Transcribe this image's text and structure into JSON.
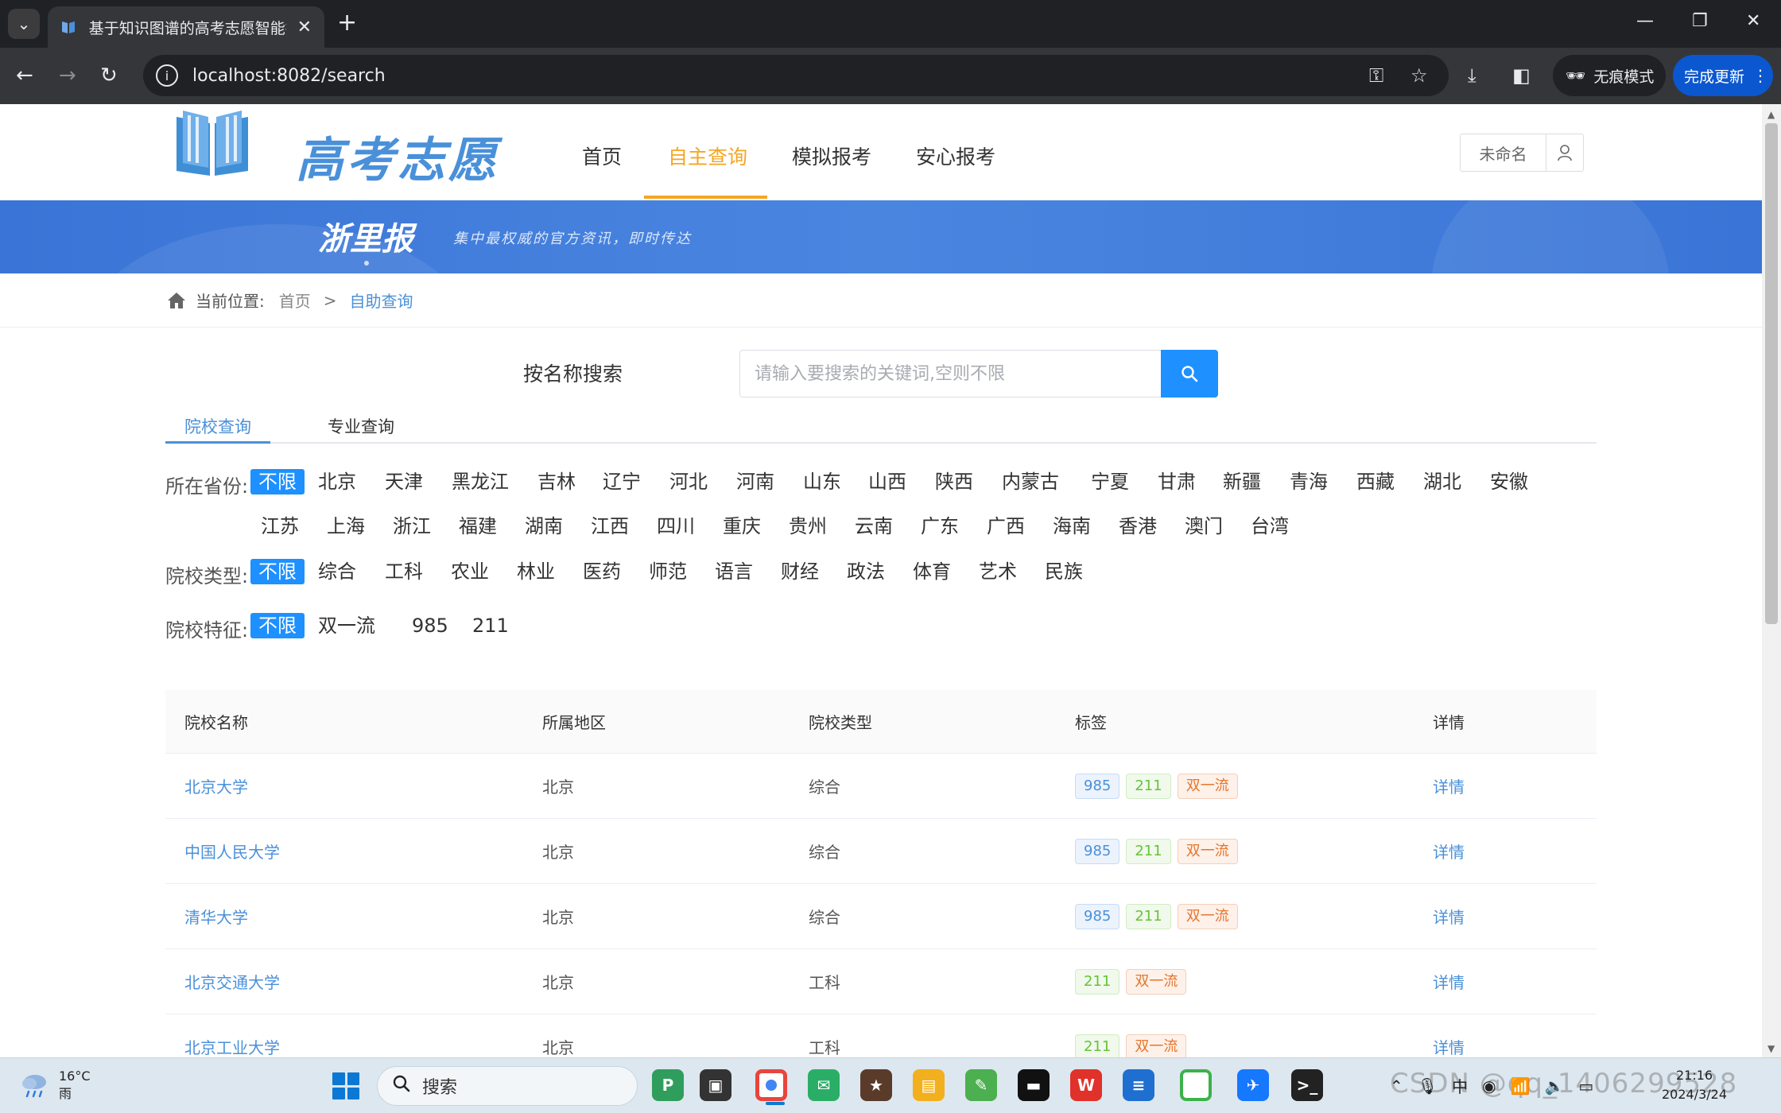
{
  "browser": {
    "tab_title": "基于知识图谱的高考志愿智能推",
    "url": "localhost:8082/search",
    "incognito_label": "无痕模式",
    "update_label": "完成更新"
  },
  "site": {
    "logo_text": "高考志愿",
    "nav": [
      {
        "label": "首页",
        "active": false
      },
      {
        "label": "自主查询",
        "active": true
      },
      {
        "label": "模拟报考",
        "active": false
      },
      {
        "label": "安心报考",
        "active": false
      }
    ],
    "user_name": "未命名",
    "banner_brand": "浙里报",
    "banner_slogan": "集中最权威的官方资讯，即时传达"
  },
  "breadcrumb": {
    "prefix": "当前位置:",
    "home": "首页",
    "sep": ">",
    "current": "自助查询"
  },
  "search": {
    "label": "按名称搜索",
    "placeholder": "请输入要搜索的关键词,空则不限"
  },
  "tabs": [
    {
      "label": "院校查询",
      "active": true
    },
    {
      "label": "专业查询",
      "active": false
    }
  ],
  "filters": {
    "province": {
      "label": "所在省份:",
      "row1": [
        "不限",
        "北京",
        "天津",
        "黑龙江",
        "吉林",
        "辽宁",
        "河北",
        "河南",
        "山东",
        "山西",
        "陕西",
        "内蒙古",
        "宁夏",
        "甘肃",
        "新疆",
        "青海",
        "西藏",
        "湖北",
        "安徽"
      ],
      "row2": [
        "江苏",
        "上海",
        "浙江",
        "福建",
        "湖南",
        "江西",
        "四川",
        "重庆",
        "贵州",
        "云南",
        "广东",
        "广西",
        "海南",
        "香港",
        "澳门",
        "台湾"
      ],
      "selected": "不限"
    },
    "type": {
      "label": "院校类型:",
      "options": [
        "不限",
        "综合",
        "工科",
        "农业",
        "林业",
        "医药",
        "师范",
        "语言",
        "财经",
        "政法",
        "体育",
        "艺术",
        "民族"
      ],
      "selected": "不限"
    },
    "feature": {
      "label": "院校特征:",
      "options": [
        "不限",
        "双一流",
        "985",
        "211"
      ],
      "selected": "不限"
    }
  },
  "table": {
    "headers": [
      "院校名称",
      "所属地区",
      "院校类型",
      "标签",
      "详情"
    ],
    "rows": [
      {
        "name": "北京大学",
        "region": "北京",
        "type": "综合",
        "tags": [
          "985",
          "211",
          "双一流"
        ],
        "detail": "详情"
      },
      {
        "name": "中国人民大学",
        "region": "北京",
        "type": "综合",
        "tags": [
          "985",
          "211",
          "双一流"
        ],
        "detail": "详情"
      },
      {
        "name": "清华大学",
        "region": "北京",
        "type": "综合",
        "tags": [
          "985",
          "211",
          "双一流"
        ],
        "detail": "详情"
      },
      {
        "name": "北京交通大学",
        "region": "北京",
        "type": "工科",
        "tags": [
          "211",
          "双一流"
        ],
        "detail": "详情"
      },
      {
        "name": "北京工业大学",
        "region": "北京",
        "type": "工科",
        "tags": [
          "211",
          "双一流"
        ],
        "detail": "详情"
      }
    ]
  },
  "taskbar": {
    "temperature": "16°C",
    "weather": "雨",
    "search_label": "搜索",
    "ime": "中",
    "time": "21:16",
    "date": "2024/3/24",
    "watermark": "CSDN @qq_1406299528"
  },
  "colors": {
    "brand_blue": "#4a90d9",
    "accent_orange": "#f5a623",
    "selected_bg": "#1e90ff"
  }
}
